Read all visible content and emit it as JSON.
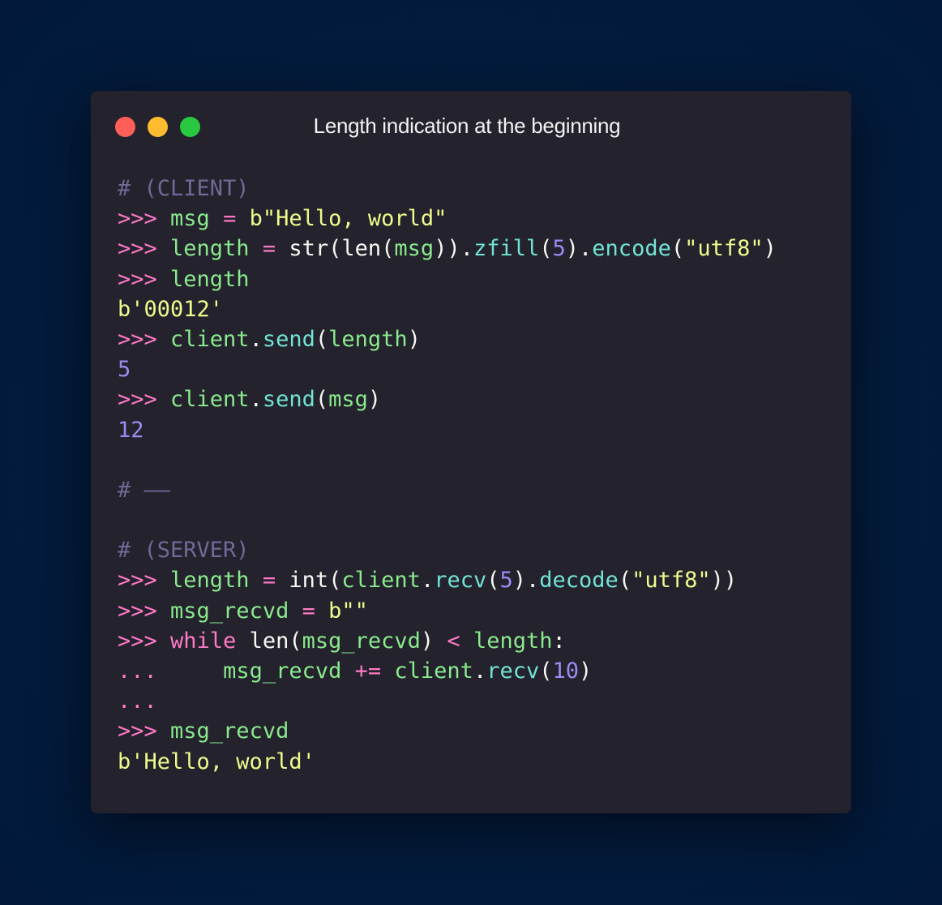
{
  "window": {
    "title": "Length indication at the beginning",
    "controls": {
      "close_color": "#ff5f57",
      "minimize_color": "#febc2e",
      "maximize_color": "#28c840"
    }
  },
  "code": {
    "lines": [
      {
        "tokens": [
          {
            "t": "# (CLIENT)",
            "c": "cmt"
          }
        ]
      },
      {
        "tokens": [
          {
            "t": ">>> ",
            "c": "prm"
          },
          {
            "t": "msg",
            "c": "var"
          },
          {
            "t": " = ",
            "c": "op"
          },
          {
            "t": "b\"Hello, world\"",
            "c": "str"
          }
        ]
      },
      {
        "tokens": [
          {
            "t": ">>> ",
            "c": "prm"
          },
          {
            "t": "length",
            "c": "var"
          },
          {
            "t": " = ",
            "c": "op"
          },
          {
            "t": "str(len(",
            "c": "pl"
          },
          {
            "t": "msg",
            "c": "var"
          },
          {
            "t": ")).",
            "c": "pl"
          },
          {
            "t": "zfill",
            "c": "fn"
          },
          {
            "t": "(",
            "c": "pl"
          },
          {
            "t": "5",
            "c": "num"
          },
          {
            "t": ").",
            "c": "pl"
          },
          {
            "t": "encode",
            "c": "fn"
          },
          {
            "t": "(",
            "c": "pl"
          },
          {
            "t": "\"utf8\"",
            "c": "str"
          },
          {
            "t": ")",
            "c": "pl"
          }
        ]
      },
      {
        "tokens": [
          {
            "t": ">>> ",
            "c": "prm"
          },
          {
            "t": "length",
            "c": "var"
          }
        ]
      },
      {
        "tokens": [
          {
            "t": "b'00012'",
            "c": "out"
          }
        ]
      },
      {
        "tokens": [
          {
            "t": ">>> ",
            "c": "prm"
          },
          {
            "t": "client",
            "c": "var"
          },
          {
            "t": ".",
            "c": "pl"
          },
          {
            "t": "send",
            "c": "fn"
          },
          {
            "t": "(",
            "c": "pl"
          },
          {
            "t": "length",
            "c": "var"
          },
          {
            "t": ")",
            "c": "pl"
          }
        ]
      },
      {
        "tokens": [
          {
            "t": "5",
            "c": "outn"
          }
        ]
      },
      {
        "tokens": [
          {
            "t": ">>> ",
            "c": "prm"
          },
          {
            "t": "client",
            "c": "var"
          },
          {
            "t": ".",
            "c": "pl"
          },
          {
            "t": "send",
            "c": "fn"
          },
          {
            "t": "(",
            "c": "pl"
          },
          {
            "t": "msg",
            "c": "var"
          },
          {
            "t": ")",
            "c": "pl"
          }
        ]
      },
      {
        "tokens": [
          {
            "t": "12",
            "c": "outn"
          }
        ]
      },
      {
        "tokens": []
      },
      {
        "tokens": [
          {
            "t": "# ——",
            "c": "cmt"
          }
        ]
      },
      {
        "tokens": []
      },
      {
        "tokens": [
          {
            "t": "# (SERVER)",
            "c": "cmt"
          }
        ]
      },
      {
        "tokens": [
          {
            "t": ">>> ",
            "c": "prm"
          },
          {
            "t": "length",
            "c": "var"
          },
          {
            "t": " = ",
            "c": "op"
          },
          {
            "t": "int(",
            "c": "pl"
          },
          {
            "t": "client",
            "c": "var"
          },
          {
            "t": ".",
            "c": "pl"
          },
          {
            "t": "recv",
            "c": "fn"
          },
          {
            "t": "(",
            "c": "pl"
          },
          {
            "t": "5",
            "c": "num"
          },
          {
            "t": ").",
            "c": "pl"
          },
          {
            "t": "decode",
            "c": "fn"
          },
          {
            "t": "(",
            "c": "pl"
          },
          {
            "t": "\"utf8\"",
            "c": "str"
          },
          {
            "t": "))",
            "c": "pl"
          }
        ]
      },
      {
        "tokens": [
          {
            "t": ">>> ",
            "c": "prm"
          },
          {
            "t": "msg_recvd",
            "c": "var"
          },
          {
            "t": " = ",
            "c": "op"
          },
          {
            "t": "b\"\"",
            "c": "str"
          }
        ]
      },
      {
        "tokens": [
          {
            "t": ">>> ",
            "c": "prm"
          },
          {
            "t": "while",
            "c": "kw"
          },
          {
            "t": " len(",
            "c": "pl"
          },
          {
            "t": "msg_recvd",
            "c": "var"
          },
          {
            "t": ") ",
            "c": "pl"
          },
          {
            "t": "<",
            "c": "op"
          },
          {
            "t": " ",
            "c": "pl"
          },
          {
            "t": "length",
            "c": "var"
          },
          {
            "t": ":",
            "c": "pl"
          }
        ]
      },
      {
        "tokens": [
          {
            "t": "...",
            "c": "prm"
          },
          {
            "t": "     ",
            "c": "pl"
          },
          {
            "t": "msg_recvd",
            "c": "var"
          },
          {
            "t": " += ",
            "c": "op"
          },
          {
            "t": "client",
            "c": "var"
          },
          {
            "t": ".",
            "c": "pl"
          },
          {
            "t": "recv",
            "c": "fn"
          },
          {
            "t": "(",
            "c": "pl"
          },
          {
            "t": "10",
            "c": "num"
          },
          {
            "t": ")",
            "c": "pl"
          }
        ]
      },
      {
        "tokens": [
          {
            "t": "...",
            "c": "prm"
          }
        ]
      },
      {
        "tokens": [
          {
            "t": ">>> ",
            "c": "prm"
          },
          {
            "t": "msg_recvd",
            "c": "var"
          }
        ]
      },
      {
        "tokens": [
          {
            "t": "b'Hello, world'",
            "c": "out"
          }
        ]
      }
    ]
  }
}
